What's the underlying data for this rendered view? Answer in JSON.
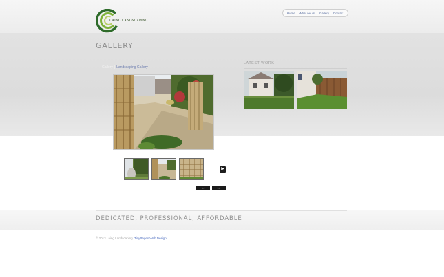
{
  "header": {
    "logo_text": "LAING LANDSCAPING",
    "nav": [
      "Home",
      "What we do",
      "Gallery",
      "Contact"
    ]
  },
  "page_title": "GALLERY",
  "breadcrumb": {
    "first": "Gallery",
    "separator": "|",
    "second": "Landscaping Gallery"
  },
  "latest": {
    "label": "LATEST WORK"
  },
  "pager": {
    "prev": "<<",
    "next": ">>"
  },
  "tagline": "DEDICATED, PROFESSIONAL, AFFORDABLE",
  "footer": {
    "copyright": "© 2013 Laing Landscaping.",
    "credit": "TinyPages Web Design."
  },
  "colors": {
    "link": "#4f6fc0",
    "nav_link": "#5a6fa0",
    "band": "#dcdcdc"
  },
  "icons": {
    "next": "play-arrow-icon"
  }
}
